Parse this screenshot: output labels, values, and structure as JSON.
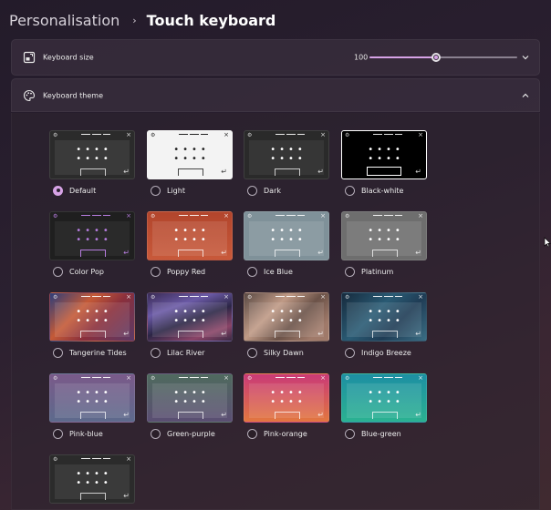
{
  "breadcrumb": {
    "parent": "Personalisation",
    "separator": "›",
    "current": "Touch keyboard"
  },
  "keyboard_size": {
    "label": "Keyboard size",
    "value": "100",
    "slider_fraction": 0.45
  },
  "keyboard_theme": {
    "label": "Keyboard theme",
    "expanded": true
  },
  "colors": {
    "accent": "#d7a3e6"
  },
  "thumbnail_glyphs": {
    "gear": "⚙",
    "close": "×",
    "dots": "••••",
    "enter": "↵"
  },
  "themes": [
    {
      "label": "Default",
      "selected": true
    },
    {
      "label": "Light",
      "selected": false
    },
    {
      "label": "Dark",
      "selected": false
    },
    {
      "label": "Black-white",
      "selected": false
    },
    {
      "label": "Color Pop",
      "selected": false
    },
    {
      "label": "Poppy Red",
      "selected": false
    },
    {
      "label": "Ice Blue",
      "selected": false
    },
    {
      "label": "Platinum",
      "selected": false
    },
    {
      "label": "Tangerine Tides",
      "selected": false
    },
    {
      "label": "Lilac River",
      "selected": false
    },
    {
      "label": "Silky Dawn",
      "selected": false
    },
    {
      "label": "Indigo Breeze",
      "selected": false
    },
    {
      "label": "Pink-blue",
      "selected": false
    },
    {
      "label": "Green-purple",
      "selected": false
    },
    {
      "label": "Pink-orange",
      "selected": false
    },
    {
      "label": "Blue-green",
      "selected": false
    }
  ]
}
